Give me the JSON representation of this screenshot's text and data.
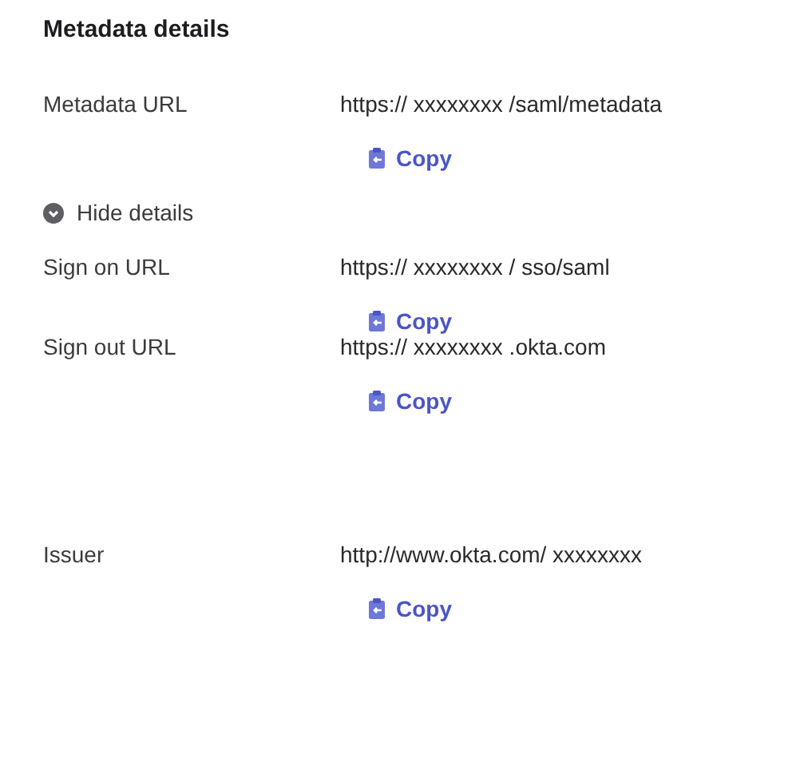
{
  "title": "Metadata details",
  "fields": [
    {
      "label": "Metadata URL",
      "value": "https:// xxxxxxxx /saml/metadata",
      "action": "Copy"
    }
  ],
  "details_toggle": {
    "label": "Hide details",
    "expanded": true
  },
  "details": [
    {
      "label": "Sign on URL",
      "value": "https:// xxxxxxxx / sso/saml",
      "action": "Copy"
    },
    {
      "label": "Sign out URL",
      "value": "https:// xxxxxxxx .okta.com",
      "action": "Copy"
    },
    {
      "label": "Issuer",
      "value": "http://www.okta.com/ xxxxxxxx",
      "action": "Copy"
    }
  ]
}
